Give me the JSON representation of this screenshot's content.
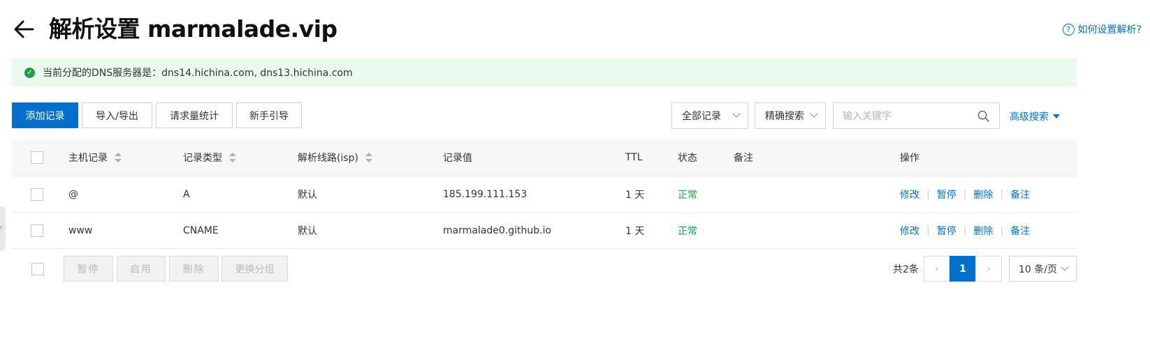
{
  "header": {
    "title": "解析设置 marmalade.vip",
    "help_link": "如何设置解析?",
    "help_icon_glyph": "?"
  },
  "banner": {
    "text": "当前分配的DNS服务器是：dns14.hichina.com, dns13.hichina.com",
    "icon": "check-circle-icon",
    "background": "#eaf9ee",
    "icon_color": "#1e9e47"
  },
  "toolbar": {
    "add_record": "添加记录",
    "import_export": "导入/导出",
    "request_stats": "请求量统计",
    "guide": "新手引导",
    "record_filter": "全部记录",
    "search_mode": "精确搜索",
    "search_placeholder": "输入关键字",
    "search_value": "",
    "advanced_search": "高级搜索"
  },
  "table": {
    "columns": {
      "host": "主机记录",
      "type": "记录类型",
      "line": "解析线路(isp)",
      "value": "记录值",
      "ttl": "TTL",
      "status": "状态",
      "remark": "备注",
      "actions": "操作"
    },
    "rows": [
      {
        "host": "@",
        "type": "A",
        "line": "默认",
        "value": "185.199.111.153",
        "ttl": "1 天",
        "status": "正常",
        "remark": ""
      },
      {
        "host": "www",
        "type": "CNAME",
        "line": "默认",
        "value": "marmalade0.github.io",
        "ttl": "1 天",
        "status": "正常",
        "remark": ""
      }
    ],
    "actions": {
      "edit": "修改",
      "pause": "暂停",
      "delete": "删除",
      "remark": "备注"
    }
  },
  "footer": {
    "pause": "暂停",
    "enable": "启用",
    "delete": "删除",
    "change_group": "更换分组",
    "total": "共2条",
    "current_page": "1",
    "page_size": "10 条/页"
  },
  "colors": {
    "accent": "#0070cc",
    "status_ok": "#1e9e47"
  }
}
